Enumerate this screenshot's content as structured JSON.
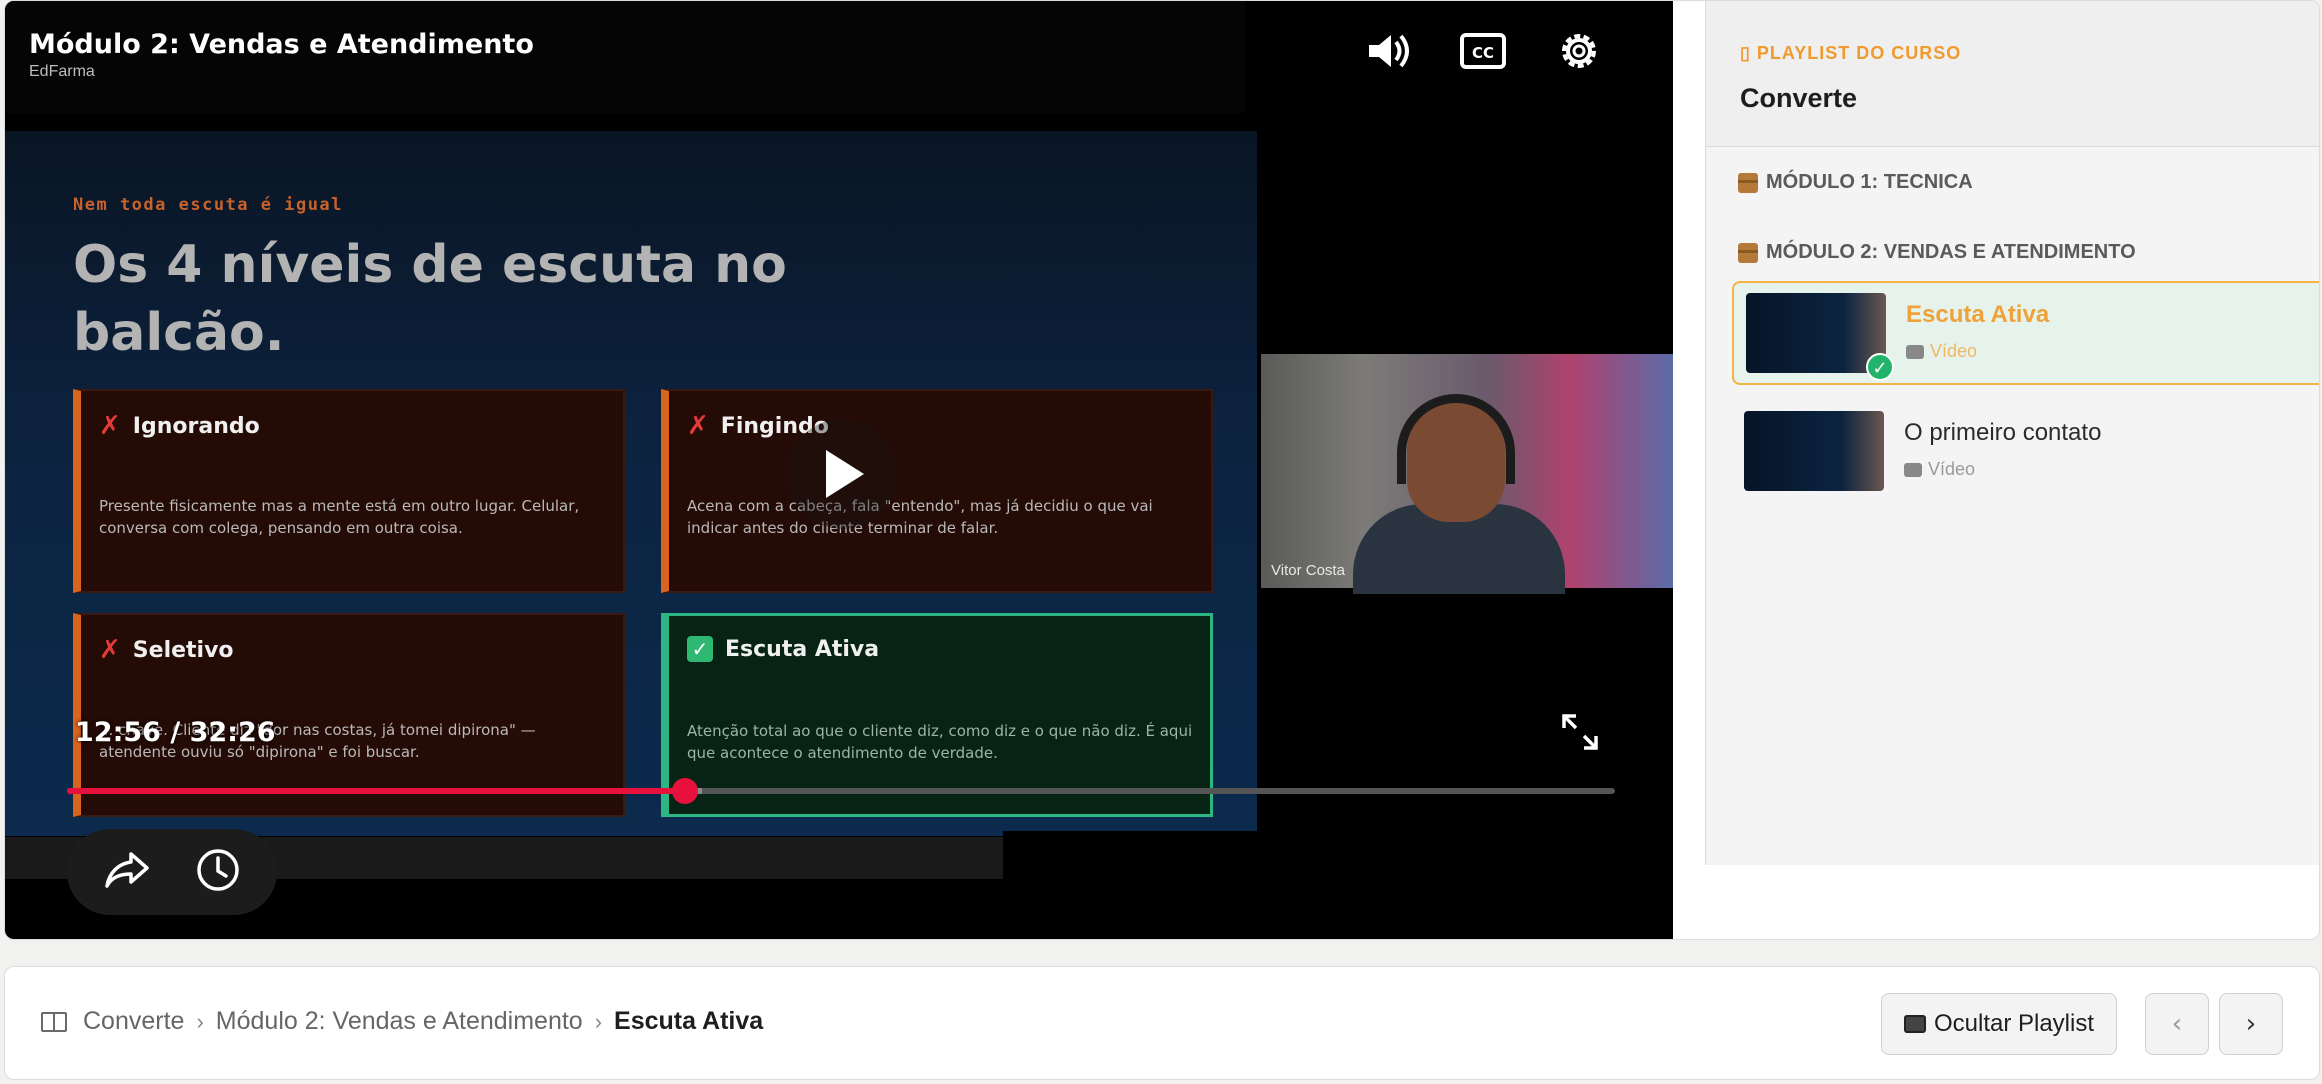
{
  "player": {
    "title": "Módulo 2: Vendas e Atendimento",
    "subtitle": "EdFarma",
    "time": "12:56 / 32:26",
    "progress": 0.399,
    "buffered": 0.41
  },
  "slide": {
    "kicker": "Nem toda escuta é igual",
    "title": "Os 4 níveis de escuta no balcão.",
    "cards": [
      {
        "title": "Ignorando",
        "marker": "✗",
        "body": "Presente fisicamente mas a mente está em outro lugar. Celular, conversa com colega, pensando em outra coisa."
      },
      {
        "title": "Fingindo",
        "marker": "✗",
        "body": "Acena com a cabeça, fala \"entendo\", mas já decidiu o que vai indicar antes do cliente terminar de falar."
      },
      {
        "title": "Seletivo",
        "marker": "✗",
        "body": "... chave. Cliente diz \"dor nas costas, já tomei dipirona\" — atendente ouviu só \"dipirona\" e foi buscar."
      },
      {
        "title": "Escuta Ativa",
        "marker": "✓",
        "body": "Atenção total ao que o cliente diz, como diz e o que não diz. É aqui que acontece o atendimento de verdade."
      }
    ]
  },
  "webcam": {
    "name": "Vitor Costa"
  },
  "icons": {
    "volume": "volume-icon",
    "captions": "captions-icon",
    "settings": "gear-icon",
    "play": "play-icon",
    "share": "share-icon",
    "history": "clock-icon",
    "fullscreen": "fullscreen-icon"
  },
  "sidebar": {
    "tag": "PLAYLIST DO CURSO",
    "course": "Converte",
    "modules": [
      {
        "label": "MÓDULO 1: TECNICA"
      },
      {
        "label": "MÓDULO 2: VENDAS E ATENDIMENTO"
      }
    ],
    "lessons": [
      {
        "title": "Escuta Ativa",
        "type": "Vídeo",
        "active": true,
        "done": true
      },
      {
        "title": "O primeiro contato",
        "type": "Vídeo",
        "active": false,
        "done": false
      }
    ]
  },
  "footer": {
    "breadcrumb": [
      "Converte",
      "Módulo 2: Vendas e Atendimento",
      "Escuta Ativa"
    ],
    "hide_playlist": "Ocultar Playlist",
    "prev": "‹",
    "next": "›"
  },
  "colors": {
    "accent": "#f09a2e",
    "progress": "#e8103c",
    "success": "#2db583"
  }
}
